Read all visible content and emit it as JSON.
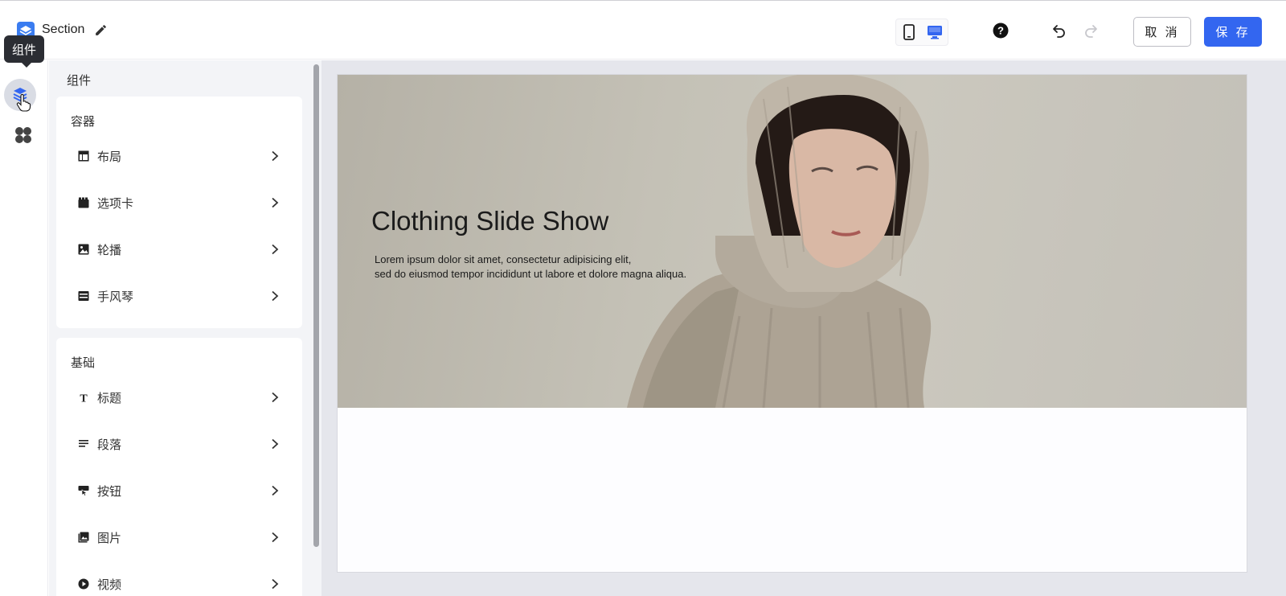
{
  "header": {
    "doc_title": "Section",
    "cancel_label": "取 消",
    "save_label": "保 存",
    "accent_color": "#3366f0",
    "device_modes": [
      "mobile",
      "desktop"
    ],
    "active_device": "desktop"
  },
  "rail": {
    "tooltip": "组件",
    "items": [
      {
        "icon": "components-icon",
        "active": true
      },
      {
        "icon": "apps-icon",
        "active": false
      }
    ]
  },
  "panel": {
    "title": "组件",
    "groups": [
      {
        "title": "容器",
        "items": [
          {
            "label": "布局",
            "icon": "layout-icon"
          },
          {
            "label": "选项卡",
            "icon": "tabs-icon"
          },
          {
            "label": "轮播",
            "icon": "carousel-icon"
          },
          {
            "label": "手风琴",
            "icon": "accordion-icon"
          }
        ]
      },
      {
        "title": "基础",
        "items": [
          {
            "label": "标题",
            "icon": "heading-icon"
          },
          {
            "label": "段落",
            "icon": "paragraph-icon"
          },
          {
            "label": "按钮",
            "icon": "button-icon"
          },
          {
            "label": "图片",
            "icon": "image-icon"
          },
          {
            "label": "视频",
            "icon": "video-icon"
          }
        ]
      }
    ]
  },
  "canvas": {
    "hero_title": "Clothing Slide Show",
    "hero_text_line1": "Lorem ipsum dolor sit amet, consectetur adipisicing elit,",
    "hero_text_line2": "sed do eiusmod tempor incididunt ut labore et dolore magna aliqua."
  }
}
